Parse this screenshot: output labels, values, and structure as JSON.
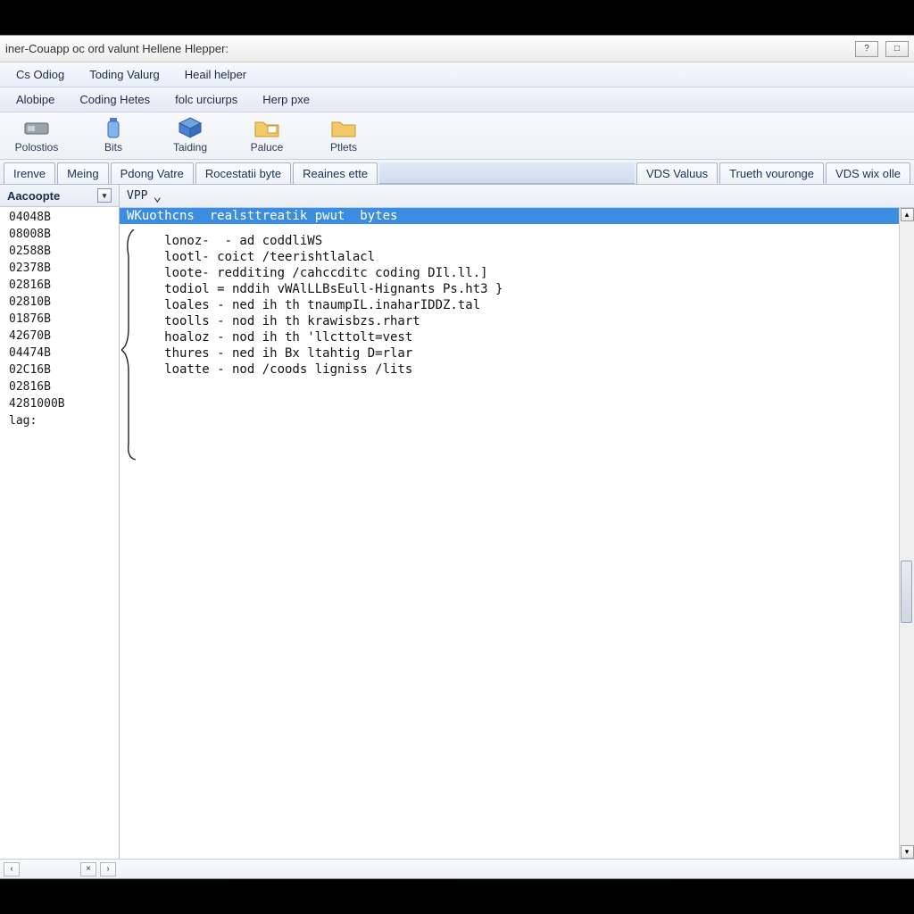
{
  "titlebar": {
    "title": "iner-Couapp oc ord valunt Hellene Hlepper:"
  },
  "window_controls": {
    "min": "?",
    "max": "□"
  },
  "menu_row1": [
    "Cs Odiog",
    "Toding Valurg",
    "Heail helper"
  ],
  "menu_row2": [
    "Alobipe",
    "Coding Hetes",
    "folc urciurps",
    "Herp pxe"
  ],
  "toolbar": [
    {
      "label": "Polostios",
      "icon": "drive"
    },
    {
      "label": "Bits",
      "icon": "bottle"
    },
    {
      "label": "Taiding",
      "icon": "cube"
    },
    {
      "label": "Paluce",
      "icon": "folder"
    },
    {
      "label": "Ptlets",
      "icon": "folder2"
    }
  ],
  "tabs_left": [
    "Irenve",
    "Meing",
    "Pdong Vatre",
    "Rocestatii byte",
    "Reaines ette"
  ],
  "tabs_right": [
    "VDS Valuus",
    "Trueth vouronge",
    "VDS wix olle"
  ],
  "sidebar": {
    "header": "Aacoopte",
    "items": [
      "04048B",
      "08008B",
      "02588B",
      "02378B",
      "02816B",
      "02810B",
      "01876B",
      "42670B",
      "04474B",
      "02C16B",
      "02816B",
      "4281000B",
      "lag:"
    ]
  },
  "editor": {
    "tab_label": "VPP",
    "lines": [
      "WKuothcns  realsttreatik pwut  bytes",
      "     lonoz-  - ad coddliWS",
      "     lootl- coict /teerishtlalacl",
      "     loote- redditing /cahccditc coding DIl.ll.]",
      "     todiol = nddih vWAlLLBsEull-Hignants Ps.ht3 }",
      "     loales - ned ih th tnaumpIL.inaharIDDZ.tal",
      "     toolls - nod ih th krawisbzs.rhart",
      "     hoaloz - nod ih th 'llcttolt=vest",
      "     thures - ned ih Bx ltahtig D=rlar",
      "     loatte - nod /coods ligniss /lits"
    ]
  },
  "statusbar": {
    "left_arrow": "‹",
    "close": "×",
    "right_arrow": "›"
  },
  "colors": {
    "selection": "#3a8de0"
  }
}
